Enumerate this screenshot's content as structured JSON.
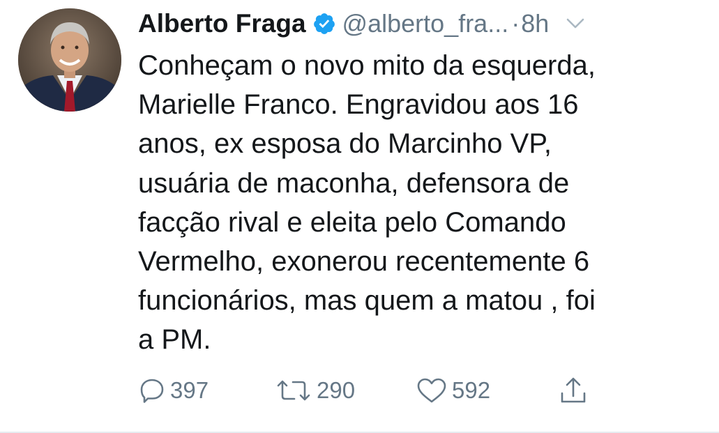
{
  "tweet": {
    "author_name": "Alberto Fraga",
    "handle": "@alberto_fra...",
    "separator": "·",
    "time": "8h",
    "verified": true,
    "lines": [
      "Conheçam o novo mito da esquerda,",
      "Marielle Franco. Engravidou aos 16",
      "anos, ex esposa do Marcinho VP,",
      "usuária de maconha, defensora de",
      "facção rival e eleita pelo Comando",
      "Vermelho, exonerou recentemente 6",
      "funcionários, mas quem a matou , foi",
      "a PM."
    ],
    "actions": {
      "replies": "397",
      "retweets": "290",
      "likes": "592"
    }
  },
  "colors": {
    "text": "#14171a",
    "secondary": "#657786",
    "verified": "#1da1f2"
  },
  "icons": [
    "verified-badge-icon",
    "chevron-down-icon",
    "reply-icon",
    "retweet-icon",
    "like-icon",
    "share-icon"
  ]
}
